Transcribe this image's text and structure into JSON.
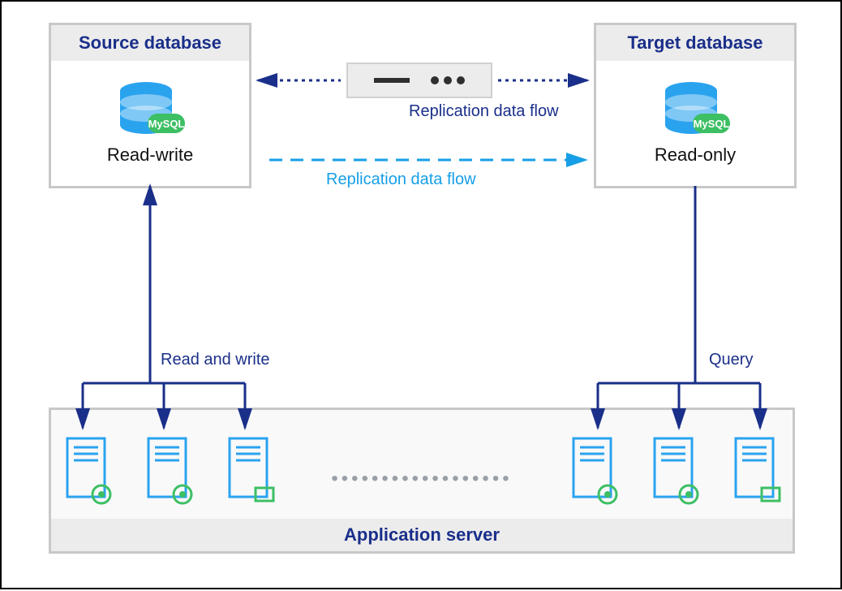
{
  "source_db": {
    "title": "Source database",
    "mode": "Read-write",
    "engine": "MySQL"
  },
  "target_db": {
    "title": "Target database",
    "mode": "Read-only",
    "engine": "MySQL"
  },
  "flows": {
    "replication_top": "Replication data flow",
    "replication_mid": "Replication data flow",
    "read_write": "Read and write",
    "query": "Query"
  },
  "appserver": {
    "title": "Application server",
    "ellipsis": "••••••••••••••••••"
  }
}
